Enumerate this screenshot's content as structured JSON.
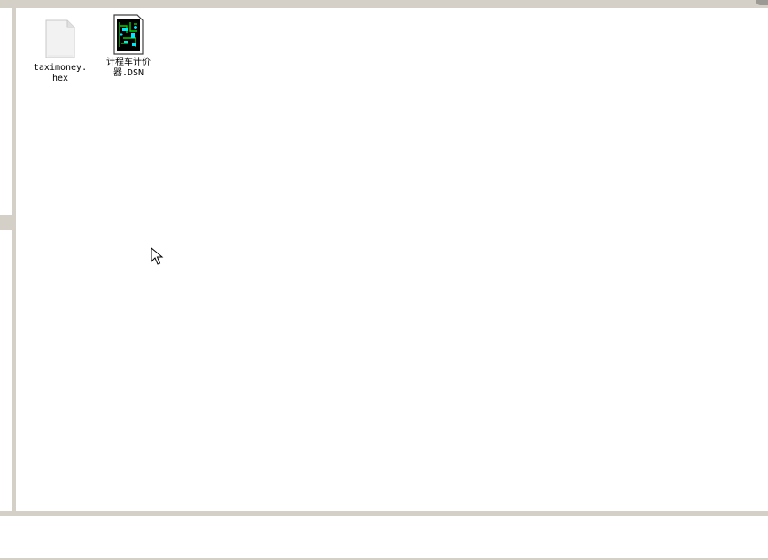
{
  "files": [
    {
      "label_line1": "taximoney.",
      "label_line2": "hex",
      "icon": "blank-document-icon"
    },
    {
      "label_line1": "计程车计价",
      "label_line2": "器.DSN",
      "icon": "circuit-design-icon"
    }
  ],
  "colors": {
    "frame": "#d4d0c8",
    "background": "#ffffff",
    "circuit_bg": "#000000",
    "circuit_green": "#00d000",
    "circuit_cyan": "#00e8ff"
  }
}
